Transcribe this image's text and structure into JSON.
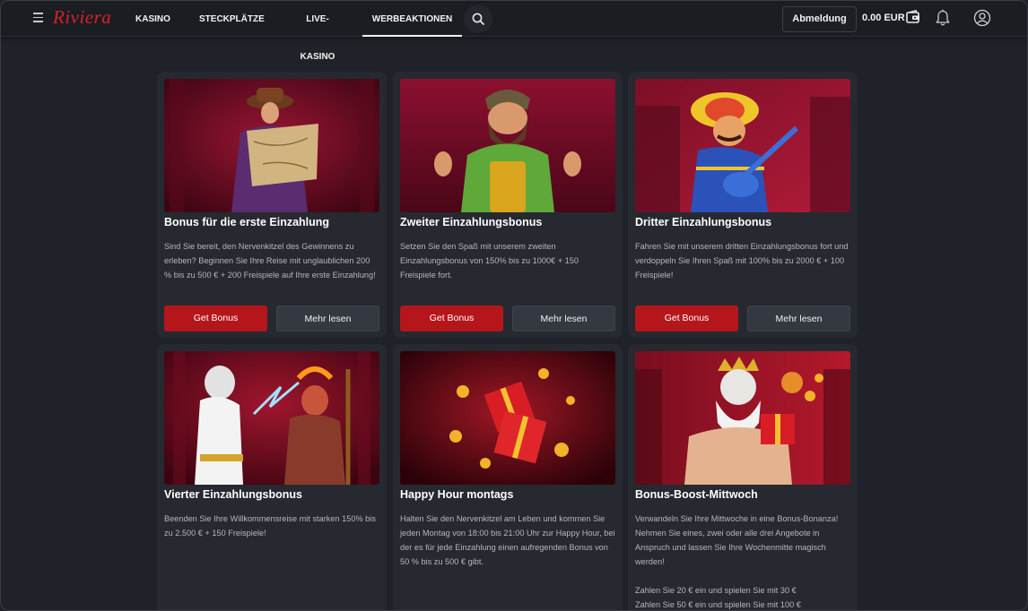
{
  "header": {
    "logo": "Riviera",
    "nav": [
      {
        "label": "KASINO"
      },
      {
        "label": "STECKPLÄTZE"
      },
      {
        "label": "LIVE-KASINO"
      },
      {
        "label": "WERBEAKTIONEN",
        "active": true
      }
    ],
    "logout_label": "Abmeldung",
    "balance": "0.00 EUR"
  },
  "promotions": [
    {
      "title": "Bonus für die erste Einzahlung",
      "description": [
        "Sind Sie bereit, den Nervenkitzel des Gewinnens zu erleben? Beginnen Sie Ihre Reise mit unglaublichen 200 % bis zu 500 € + 200 Freispiele auf Ihre erste Einzahlung!"
      ],
      "primary_label": "Get Bonus",
      "secondary_label": "Mehr lesen"
    },
    {
      "title": "Zweiter Einzahlungsbonus",
      "description": [
        "Setzen Sie den Spaß mit unserem zweiten Einzahlungsbonus von 150% bis zu 1000€ + 150 Freispiele fort."
      ],
      "primary_label": "Get Bonus",
      "secondary_label": "Mehr lesen"
    },
    {
      "title": "Dritter Einzahlungsbonus",
      "description": [
        "Fahren Sie mit unserem dritten Einzahlungsbonus fort und verdoppeln Sie Ihren Spaß mit 100% bis zu 2000 € + 100 Freispiele!"
      ],
      "primary_label": "Get Bonus",
      "secondary_label": "Mehr lesen"
    },
    {
      "title": "Vierter Einzahlungsbonus",
      "description": [
        "Beenden Sie Ihre Willkommensreise mit starken 150% bis zu 2.500 € + 150 Freispiele!"
      ]
    },
    {
      "title": "Happy Hour montags",
      "description": [
        "Halten Sie den Nervenkitzel am Leben und kommen Sie jeden Montag von 18:00 bis 21:00 Uhr zur Happy Hour, bei der es für jede Einzahlung einen aufregenden Bonus von 50 % bis zu 500 € gibt."
      ]
    },
    {
      "title": "Bonus-Boost-Mittwoch",
      "description": [
        "Verwandeln Sie Ihre Mittwoche in eine Bonus-Bonanza! Nehmen Sie eines, zwei oder alle drei Angebote in Anspruch und lassen Sie Ihre Wochenmitte magisch werden!",
        "Zahlen Sie 20 € ein und spielen Sie mit 30 € Zahlen Sie 50 € ein und spielen Sie mit 100 €"
      ]
    }
  ],
  "colors": {
    "brand": "#c3262a",
    "accent_button": "#b5161b",
    "background": "#1f2228",
    "card": "#262930"
  },
  "icons": [
    "menu-icon",
    "search-icon",
    "wallet-icon",
    "bell-icon",
    "user-icon"
  ]
}
